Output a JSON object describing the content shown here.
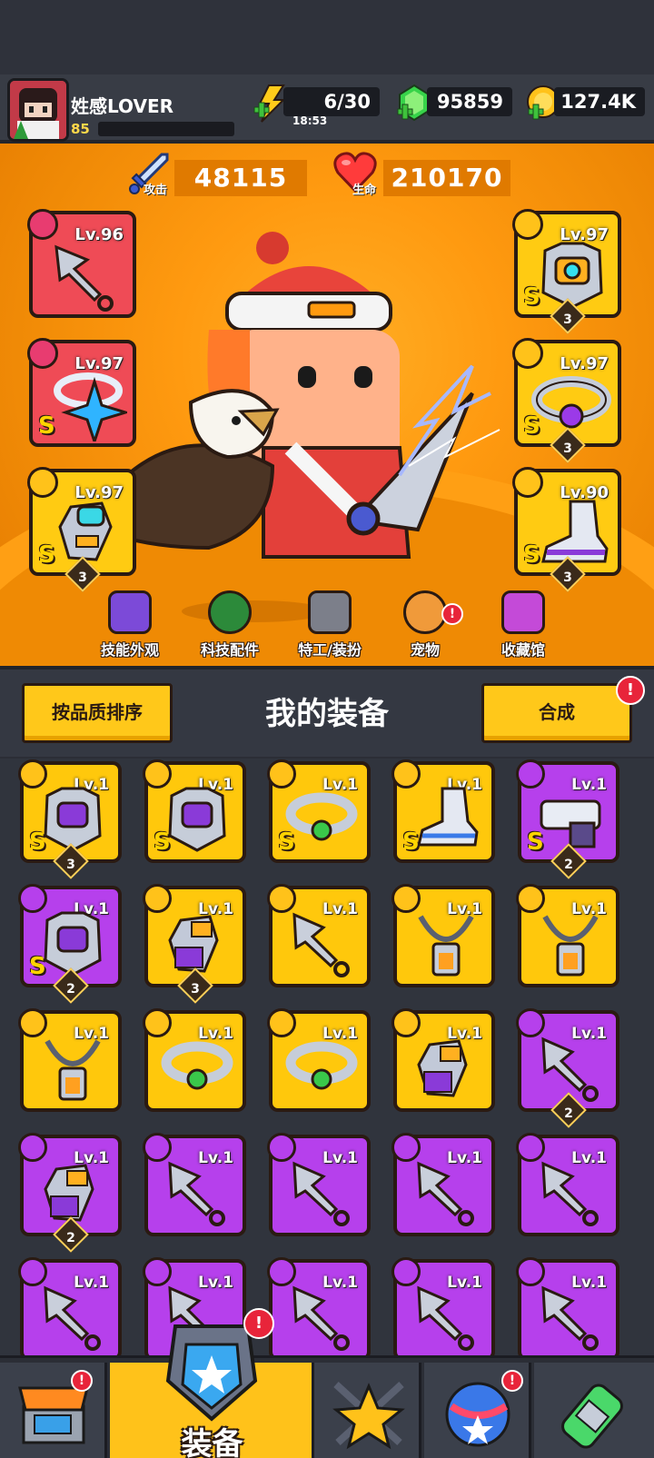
{
  "player": {
    "name": "姓感LOVER",
    "level": "85"
  },
  "resources": {
    "energy": "6/30",
    "energy_timer": "18:53",
    "gems": "95859",
    "coins": "127.4K"
  },
  "stats": {
    "attack_label": "攻击",
    "attack_value": "48115",
    "hp_label": "生命",
    "hp_value": "210170"
  },
  "equipped": {
    "left": [
      {
        "level": "Lv.96",
        "item": "kunai",
        "grade": "",
        "stars": ""
      },
      {
        "level": "Lv.97",
        "item": "ring",
        "grade": "S",
        "stars": ""
      },
      {
        "level": "Lv.97",
        "item": "glove",
        "grade": "S",
        "stars": "3"
      }
    ],
    "right": [
      {
        "level": "Lv.97",
        "item": "armor",
        "grade": "S",
        "stars": "3"
      },
      {
        "level": "Lv.97",
        "item": "belt",
        "grade": "S",
        "stars": "3"
      },
      {
        "level": "Lv.90",
        "item": "boots",
        "grade": "S",
        "stars": "3"
      }
    ]
  },
  "hero_nav": [
    {
      "label": "技能外观",
      "icon": "skill-skin-icon"
    },
    {
      "label": "科技配件",
      "icon": "tech-parts-icon"
    },
    {
      "label": "特工/装扮",
      "icon": "agent-costume-icon"
    },
    {
      "label": "宠物",
      "icon": "pet-icon",
      "alert": "!"
    },
    {
      "label": "收藏馆",
      "icon": "collection-icon"
    }
  ],
  "equipment": {
    "sort_label": "按品质排序",
    "title": "我的装备",
    "merge_label": "合成",
    "merge_alert": "!"
  },
  "inventory": [
    {
      "level": "Lv.1",
      "rarity": "gold",
      "grade": "S",
      "stars": "3",
      "item": "armor"
    },
    {
      "level": "Lv.1",
      "rarity": "gold",
      "grade": "S",
      "stars": "",
      "item": "armor"
    },
    {
      "level": "Lv.1",
      "rarity": "gold",
      "grade": "S",
      "stars": "",
      "item": "belt"
    },
    {
      "level": "Lv.1",
      "rarity": "gold",
      "grade": "S",
      "stars": "",
      "item": "boots"
    },
    {
      "level": "Lv.1",
      "rarity": "purple",
      "grade": "S",
      "stars": "2",
      "item": "gun"
    },
    {
      "level": "Lv.1",
      "rarity": "purple",
      "grade": "S",
      "stars": "2",
      "item": "armor"
    },
    {
      "level": "Lv.1",
      "rarity": "gold",
      "grade": "",
      "stars": "3",
      "item": "glove"
    },
    {
      "level": "Lv.1",
      "rarity": "gold",
      "grade": "",
      "stars": "",
      "item": "kunai"
    },
    {
      "level": "Lv.1",
      "rarity": "gold",
      "grade": "",
      "stars": "",
      "item": "necklace"
    },
    {
      "level": "Lv.1",
      "rarity": "gold",
      "grade": "",
      "stars": "",
      "item": "necklace"
    },
    {
      "level": "Lv.1",
      "rarity": "gold",
      "grade": "",
      "stars": "",
      "item": "necklace"
    },
    {
      "level": "Lv.1",
      "rarity": "gold",
      "grade": "",
      "stars": "",
      "item": "belt"
    },
    {
      "level": "Lv.1",
      "rarity": "gold",
      "grade": "",
      "stars": "",
      "item": "belt"
    },
    {
      "level": "Lv.1",
      "rarity": "gold",
      "grade": "",
      "stars": "",
      "item": "glove"
    },
    {
      "level": "Lv.1",
      "rarity": "purple",
      "grade": "",
      "stars": "2",
      "item": "kunai"
    },
    {
      "level": "Lv.1",
      "rarity": "purple",
      "grade": "",
      "stars": "2",
      "item": "glove"
    },
    {
      "level": "Lv.1",
      "rarity": "purple",
      "grade": "",
      "stars": "",
      "item": "kunai"
    },
    {
      "level": "Lv.1",
      "rarity": "purple",
      "grade": "",
      "stars": "",
      "item": "kunai"
    },
    {
      "level": "Lv.1",
      "rarity": "purple",
      "grade": "",
      "stars": "",
      "item": "kunai"
    },
    {
      "level": "Lv.1",
      "rarity": "purple",
      "grade": "",
      "stars": "",
      "item": "kunai"
    },
    {
      "level": "Lv.1",
      "rarity": "purple",
      "grade": "",
      "stars": "",
      "item": "kunai"
    },
    {
      "level": "Lv.1",
      "rarity": "purple",
      "grade": "",
      "stars": "",
      "item": "kunai"
    },
    {
      "level": "Lv.1",
      "rarity": "purple",
      "grade": "",
      "stars": "",
      "item": "kunai"
    },
    {
      "level": "Lv.1",
      "rarity": "purple",
      "grade": "",
      "stars": "",
      "item": "kunai"
    },
    {
      "level": "Lv.1",
      "rarity": "purple",
      "grade": "",
      "stars": "",
      "item": "kunai"
    }
  ],
  "bottom_nav": [
    {
      "icon": "shop-icon",
      "alert": "!"
    },
    {
      "label": "装备",
      "icon": "equipment-icon",
      "alert": "!",
      "active": true
    },
    {
      "icon": "talent-star-icon"
    },
    {
      "icon": "planet-icon",
      "alert": "!"
    },
    {
      "icon": "gene-capsule-icon"
    }
  ],
  "colors": {
    "hero_bg": "#ff9a10",
    "gold_slot": "#ffc80c",
    "purple_slot": "#b640ec",
    "red_slot": "#ef4b56",
    "alert": "#e8243a"
  }
}
